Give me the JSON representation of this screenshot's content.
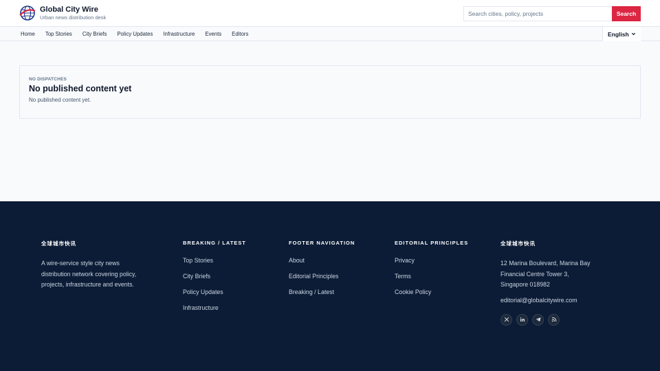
{
  "brand": {
    "title": "Global City Wire",
    "subtitle": "Urban news distribution desk",
    "logo_icon": "globe-icon"
  },
  "search": {
    "placeholder": "Search cities, policy, projects",
    "value": "",
    "button_label": "Search"
  },
  "nav": {
    "items": [
      "Home",
      "Top Stories",
      "City Briefs",
      "Policy Updates",
      "Infrastructure",
      "Events",
      "Editors"
    ],
    "language": "English"
  },
  "empty_state": {
    "eyebrow": "NO DISPATCHES",
    "title": "No published content yet",
    "body": "No published content yet."
  },
  "footer": {
    "about": {
      "title": "全球城市快讯",
      "text": "A wire-service style city news distribution network covering policy, projects, infrastructure and events."
    },
    "breaking": {
      "title": "BREAKING / LATEST",
      "links": [
        "Top Stories",
        "City Briefs",
        "Policy Updates",
        "Infrastructure"
      ]
    },
    "navigation": {
      "title": "FOOTER NAVIGATION",
      "links": [
        "About",
        "Editorial Principles",
        "Breaking / Latest"
      ]
    },
    "editorial": {
      "title": "EDITORIAL PRINCIPLES",
      "links": [
        "Privacy",
        "Terms",
        "Cookie Policy"
      ]
    },
    "contact": {
      "title": "全球城市快讯",
      "address_lines": [
        "12 Marina Boulevard, Marina Bay",
        "Financial Centre Tower 3,",
        "Singapore 018982"
      ],
      "email": "editorial@globalcitywire.com",
      "socials": [
        "x-icon",
        "linkedin-icon",
        "telegram-icon",
        "rss-icon"
      ]
    }
  },
  "colors": {
    "accent": "#dc2642",
    "footer_bg": "#0c1c36",
    "page_bg": "#f8fafc"
  }
}
